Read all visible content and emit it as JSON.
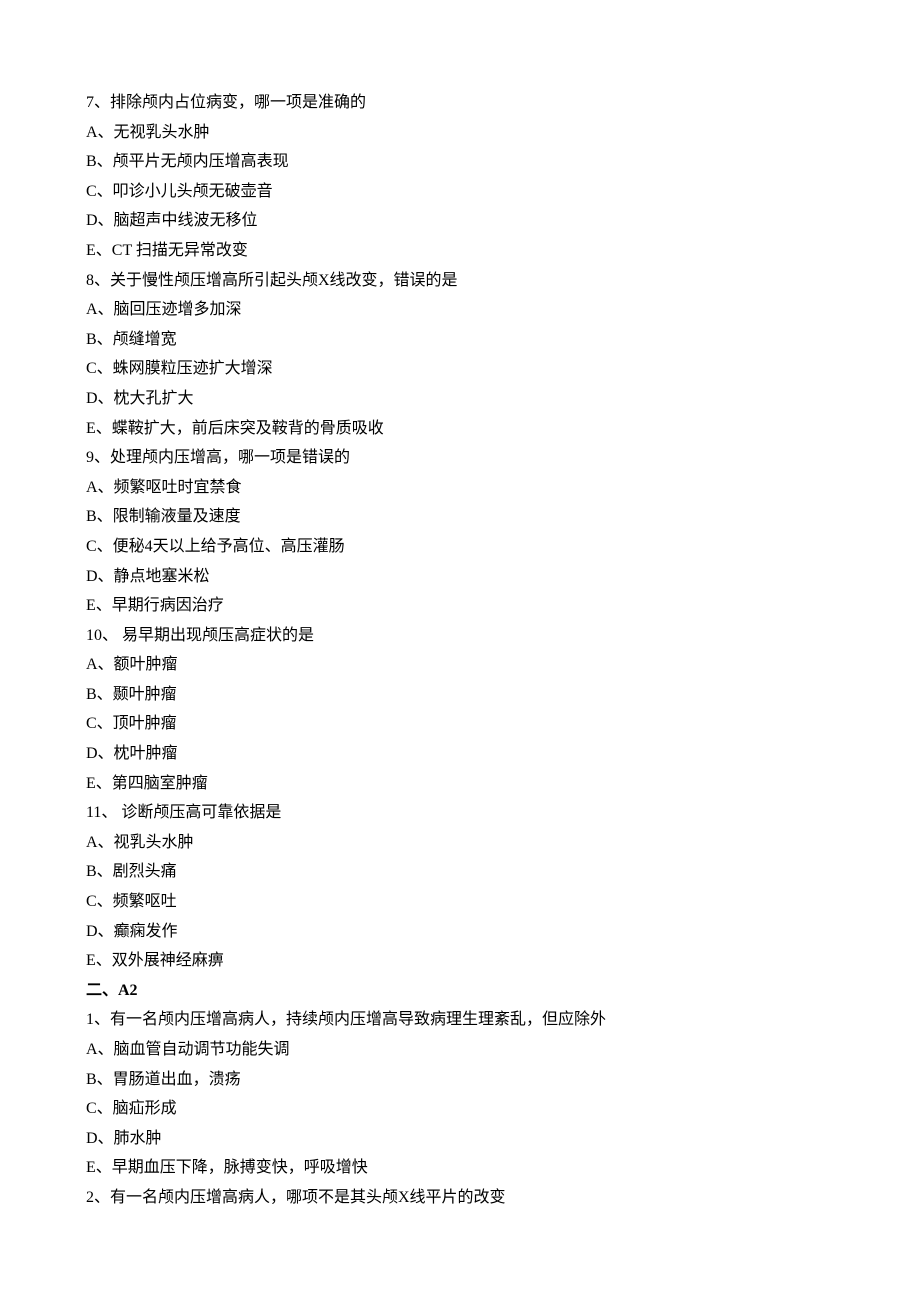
{
  "content": {
    "q7": {
      "stem": "7、排除颅内占位病变，哪一项是准确的",
      "opts": {
        "A": "A、无视乳头水肿",
        "B": "B、颅平片无颅内压增高表现",
        "C": "C、叩诊小儿头颅无破壶音",
        "D": "D、脑超声中线波无移位",
        "E": "E、CT 扫描无异常改变"
      }
    },
    "q8": {
      "stem": "8、关于慢性颅压增高所引起头颅X线改变，错误的是",
      "opts": {
        "A": "A、脑回压迹增多加深",
        "B": "B、颅缝增宽",
        "C": "C、蛛网膜粒压迹扩大增深",
        "D": "D、枕大孔扩大",
        "E": "E、蝶鞍扩大，前后床突及鞍背的骨质吸收"
      }
    },
    "q9": {
      "stem": "9、处理颅内压增高，哪一项是错误的",
      "opts": {
        "A": "A、频繁呕吐时宜禁食",
        "B": "B、限制输液量及速度",
        "C": "C、便秘4天以上给予高位、高压灌肠",
        "D": "D、静点地塞米松",
        "E": "E、早期行病因治疗"
      }
    },
    "q10": {
      "stem": "10、 易早期出现颅压高症状的是",
      "opts": {
        "A": "A、额叶肿瘤",
        "B": "B、颞叶肿瘤",
        "C": "C、顶叶肿瘤",
        "D": "D、枕叶肿瘤",
        "E": "E、第四脑室肿瘤"
      }
    },
    "q11": {
      "stem": "11、 诊断颅压高可靠依据是",
      "opts": {
        "A": "A、视乳头水肿",
        "B": "B、剧烈头痛",
        "C": "C、频繁呕吐",
        "D": "D、癫痫发作",
        "E": "E、双外展神经麻痹"
      }
    },
    "section2": {
      "heading": "二、A2",
      "q1": {
        "stem": "1、有一名颅内压增高病人，持续颅内压增高导致病理生理紊乱，但应除外",
        "opts": {
          "A": "A、脑血管自动调节功能失调",
          "B": "B、胃肠道出血，溃疡",
          "C": "C、脑疝形成",
          "D": "D、肺水肿",
          "E": "E、早期血压下降，脉搏变快，呼吸增快"
        }
      },
      "q2": {
        "stem": "2、有一名颅内压增高病人，哪项不是其头颅X线平片的改变"
      }
    }
  }
}
